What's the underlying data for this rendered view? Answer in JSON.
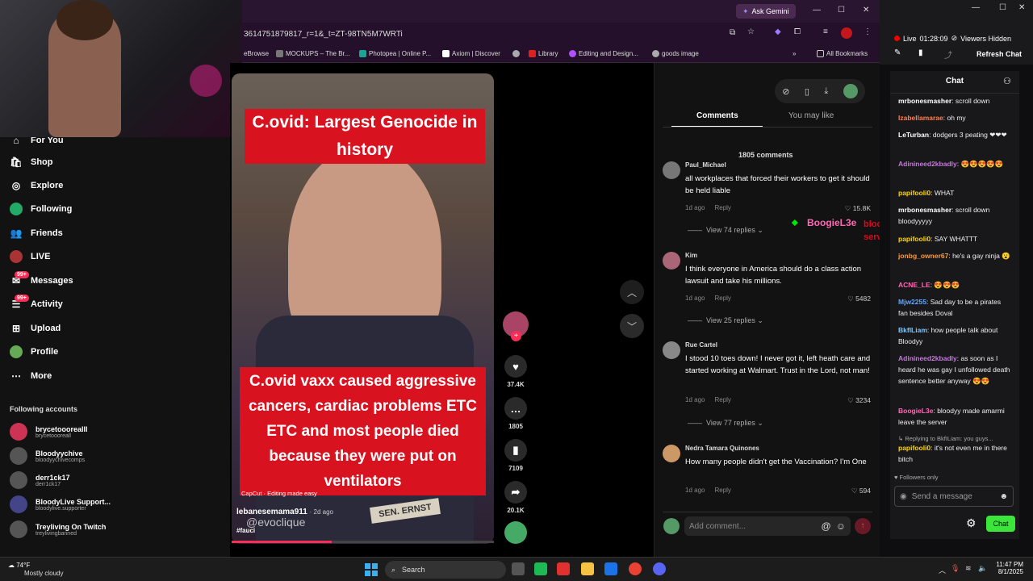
{
  "browser": {
    "ask_gemini": "Ask Gemini",
    "url_fragment": "3614751879817_r=1&_t=ZT-98TN5M7WRTi",
    "bookmarks": [
      "eBrowse",
      "MOCKUPS – The Br...",
      "Photopea | Online P...",
      "Axiom | Discover",
      "Library",
      "Editing and Design...",
      "goods image"
    ],
    "all_bookmarks": "All Bookmarks",
    "window_controls": {
      "minimize": "—",
      "maximize": "☐",
      "close": "✕"
    }
  },
  "tiktok_nav": [
    {
      "label": "For You",
      "icon": "home-icon"
    },
    {
      "label": "Shop",
      "icon": "shop-icon"
    },
    {
      "label": "Explore",
      "icon": "compass-icon"
    },
    {
      "label": "Following",
      "icon": "following-icon"
    },
    {
      "label": "Friends",
      "icon": "friends-icon"
    },
    {
      "label": "LIVE",
      "icon": "live-icon"
    },
    {
      "label": "Messages",
      "icon": "messages-icon",
      "badge": "99+"
    },
    {
      "label": "Activity",
      "icon": "activity-icon",
      "badge": "99+"
    },
    {
      "label": "Upload",
      "icon": "upload-icon"
    },
    {
      "label": "Profile",
      "icon": "profile-icon"
    },
    {
      "label": "More",
      "icon": "more-icon"
    }
  ],
  "following_accounts": {
    "header": "Following accounts",
    "items": [
      {
        "name": "brycetooorealll",
        "handle": "brycetoooreall"
      },
      {
        "name": "Bloodyychive",
        "handle": "bloodyychivecomps"
      },
      {
        "name": "derr1ck17",
        "handle": "derr1ck17"
      },
      {
        "name": "BloodyLive Support...",
        "handle": "bloodylive.supporter"
      },
      {
        "name": "Treyliving On Twitch",
        "handle": "treylivingbanned"
      }
    ]
  },
  "video": {
    "caption_top": "C.ovid:  Largest Genocide in history",
    "caption_bottom": "C.ovid vaxx caused aggressive cancers,  cardiac problems ETC ETC and most people died because they were put on ventilators",
    "capcut_label": "CapCut · Editing made easy",
    "author": "lebanesemama911",
    "posted": "· 2d ago",
    "hashtag": "#fauci",
    "watermark": "@evoclique",
    "nameplate": "SEN. ERNST",
    "progress": 0.38
  },
  "actions": {
    "likes": "37.4K",
    "comments": "1805",
    "saves": "7109",
    "shares": "20.1K"
  },
  "comments_panel": {
    "tabs": [
      "Comments",
      "You may like"
    ],
    "count_label": "1805 comments",
    "reply_label": "Reply",
    "items": [
      {
        "user": "Paul_Michael",
        "text": "all workplaces that forced their workers to get it should be held liable",
        "time": "1d ago",
        "likes": "15.8K",
        "view_replies": "View 74 replies"
      },
      {
        "user": "Kim",
        "text": "I think everyone in America should do a class action lawsuit and take his millions.",
        "time": "1d ago",
        "likes": "5482",
        "view_replies": "View 25 replies"
      },
      {
        "user": "Rue Cartel",
        "text": "I stood 10 toes down! I never got it, left heath care and started working at Walmart. Trust in the Lord, not man!",
        "time": "1d ago",
        "likes": "3234",
        "view_replies": "View 77 replies"
      },
      {
        "user": "Nedra Tamara Quinones",
        "text": "How many people didn't get the Vaccination? I'm One",
        "time": "1d ago",
        "likes": "594",
        "view_replies": ""
      }
    ],
    "add_comment_placeholder": "Add comment..."
  },
  "overlay_alert": {
    "user": "BoogieL3e",
    "text": "bloodyy made amarmi leave the server"
  },
  "twitch": {
    "live_label": "Live",
    "live_time": "01:28:09",
    "viewers": "Viewers Hidden",
    "refresh": "Refresh Chat",
    "chat_title": "Chat",
    "messages": [
      {
        "user": "mrbonesmasher",
        "color": "#ffffff",
        "text": "scroll down"
      },
      {
        "user": "Izabellamarae",
        "color": "#ff7f50",
        "text": "oh my"
      },
      {
        "user": "LeTurban",
        "color": "#ffffff",
        "text": "dodgers 3 peating ❤❤❤"
      },
      {
        "user": "Adinineed2kbadly",
        "color": "#c678dd",
        "text": "😍😍😍😍😍"
      },
      {
        "user": "papifooli0",
        "color": "#ffd700",
        "text": "WHAT"
      },
      {
        "user": "mrbonesmasher",
        "color": "#ffffff",
        "text": "scroll down bloodyyyyy"
      },
      {
        "user": "papifooli0",
        "color": "#ffd700",
        "text": "SAY WHATTT"
      },
      {
        "user": "jonbg_owner67",
        "color": "#ff9a3c",
        "text": "he's a gay ninja 😮"
      },
      {
        "user": "ACNE_LE",
        "color": "#ff69b4",
        "text": "😍😍😍"
      },
      {
        "user": "Mjw2255",
        "color": "#5fa8ff",
        "text": "Sad day to be a pirates fan besides Doval"
      },
      {
        "user": "BkfILiam",
        "color": "#7fc8ff",
        "text": "how people talk about Bloodyy"
      },
      {
        "user": "Adinineed2kbadly",
        "color": "#c678dd",
        "text": "as soon as I heard he was gay I unfollowed death sentence better anyway 😍😍"
      },
      {
        "user": "BoogieL3e",
        "color": "#ff69b4",
        "text": "bloodyy made amarmi leave the server"
      }
    ],
    "reply_context": "Replying to BkfILiam: you guys...",
    "reply_msg": {
      "user": "papifooli0",
      "color": "#ffd700",
      "text": "it's not even me in there bitch"
    },
    "followers_only": "Followers only",
    "input_placeholder": "Send a message",
    "send_label": "Chat"
  },
  "taskbar": {
    "weather_temp": "74°F",
    "weather_desc": "Mostly cloudy",
    "search": "Search",
    "time": "11:47 PM",
    "date": "8/1/2025"
  },
  "colors": {
    "tiktok_red": "#fe2c55",
    "caption_red": "#d9121f",
    "twitch_purple": "#9147ff",
    "chat_button_green": "#3ae63a",
    "alert_green": "#00e600"
  }
}
